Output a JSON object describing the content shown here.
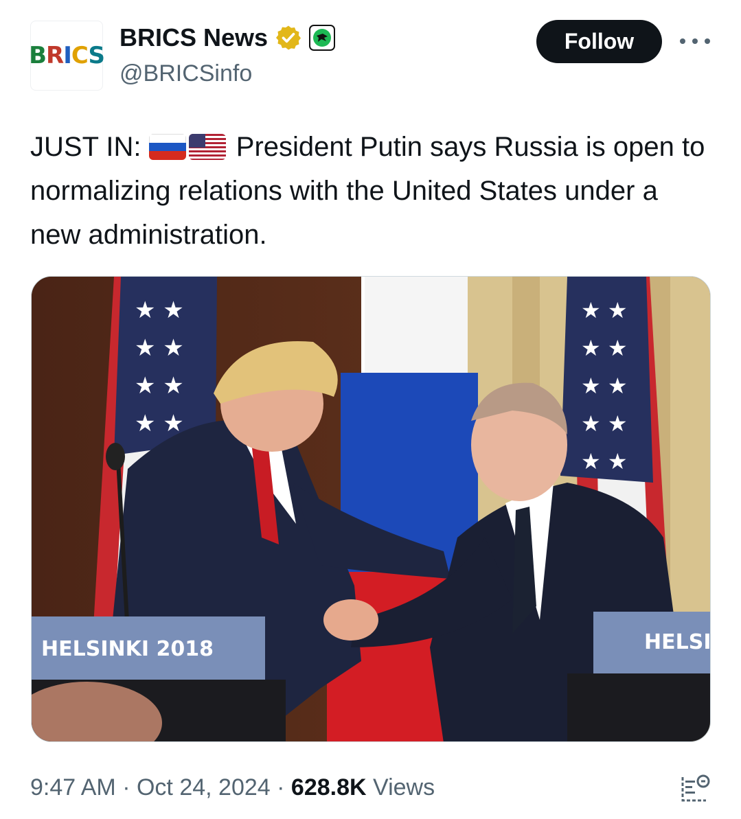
{
  "author": {
    "display_name": "BRICS News",
    "handle": "@BRICSinfo",
    "avatar_text": "BRICS",
    "verified_icon": "verified-gold-icon",
    "affiliate_badge_icon": "affiliate-badge-icon"
  },
  "actions": {
    "follow_label": "Follow",
    "more_icon": "more-options-icon"
  },
  "tweet": {
    "prefix": "JUST IN:",
    "flags": [
      "russia-flag-icon",
      "usa-flag-icon"
    ],
    "body": "President Putin says Russia is open to normalizing relations with the United States under a new administration."
  },
  "media": {
    "podium_left_text": "HELSINKI 2018",
    "podium_right_text": "HELSI"
  },
  "meta": {
    "time": "9:47 AM",
    "separator": "·",
    "date": "Oct 24, 2024",
    "views_count": "628.8K",
    "views_label": "Views",
    "analytics_icon": "grok-analyze-icon"
  },
  "colors": {
    "follow_bg": "#0f1419",
    "secondary_text": "#536471",
    "verified_gold": "#e2b719"
  }
}
